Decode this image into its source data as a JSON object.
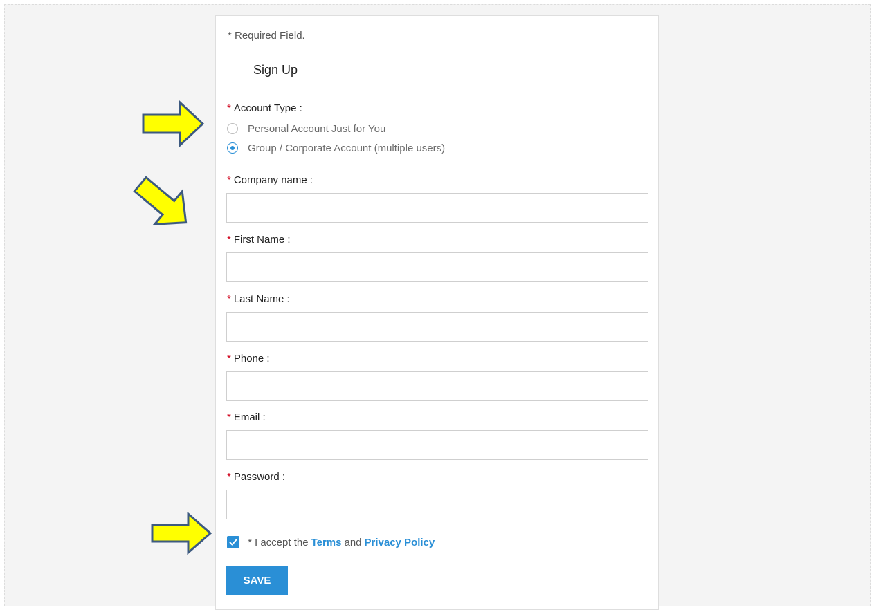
{
  "form": {
    "required_note": "* Required Field.",
    "legend": "Sign Up",
    "account_type": {
      "label": "Account Type",
      "options": [
        {
          "label": "Personal Account Just for You",
          "selected": false
        },
        {
          "label": "Group / Corporate Account (multiple users)",
          "selected": true
        }
      ]
    },
    "fields": [
      {
        "label": "Company name",
        "value": ""
      },
      {
        "label": "First Name",
        "value": ""
      },
      {
        "label": "Last Name",
        "value": ""
      },
      {
        "label": "Phone",
        "value": ""
      },
      {
        "label": "Email",
        "value": ""
      },
      {
        "label": "Password",
        "value": ""
      }
    ],
    "terms": {
      "checked": true,
      "prefix": "* I accept the",
      "terms_link": "Terms",
      "conjunction": "and",
      "privacy_link": "Privacy Policy"
    },
    "save_label": "SAVE"
  },
  "colors": {
    "accent": "#2a8fd6",
    "required_star": "#d0021b",
    "arrow_fill": "#ffff00",
    "arrow_stroke": "#3d5a80"
  },
  "annotations": [
    "arrow-icon",
    "arrow-icon",
    "arrow-icon"
  ]
}
